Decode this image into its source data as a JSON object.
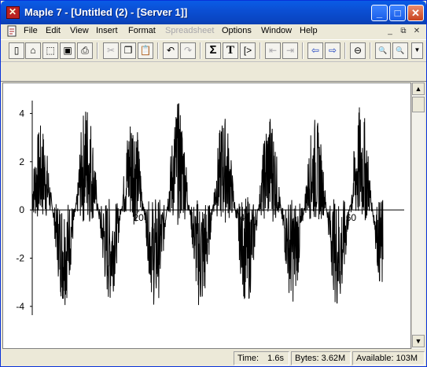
{
  "window": {
    "title": "Maple 7  - [Untitled (2) - [Server 1]]",
    "controls": {
      "minimize": "_",
      "maximize": "□",
      "close": "✕"
    }
  },
  "menubar": {
    "items": [
      "File",
      "Edit",
      "View",
      "Insert",
      "Format",
      "Spreadsheet",
      "Options",
      "Window",
      "Help"
    ],
    "disabled": [
      "Spreadsheet"
    ],
    "mdi_controls": [
      "_",
      "⧉",
      "✕"
    ]
  },
  "toolbar": {
    "buttons": [
      {
        "icon": "new-document-icon",
        "glyph": "▯"
      },
      {
        "icon": "open-folder-icon",
        "glyph": "⌂"
      },
      {
        "icon": "open-url-icon",
        "glyph": "⬚"
      },
      {
        "icon": "save-icon",
        "glyph": "▣"
      },
      {
        "icon": "print-icon",
        "glyph": "⎙"
      },
      {
        "icon": "cut-icon",
        "glyph": "✂",
        "disabled": true
      },
      {
        "icon": "copy-icon",
        "glyph": "❐"
      },
      {
        "icon": "paste-icon",
        "glyph": "📋"
      },
      {
        "icon": "undo-icon",
        "glyph": "↶"
      },
      {
        "icon": "redo-icon",
        "glyph": "↷",
        "disabled": true
      },
      {
        "icon": "sigma-math-icon",
        "glyph": "Σ"
      },
      {
        "icon": "text-mode-icon",
        "glyph": "T"
      },
      {
        "icon": "exec-group-icon",
        "glyph": "[>"
      },
      {
        "icon": "outdent-icon",
        "glyph": "⇤",
        "disabled": true
      },
      {
        "icon": "indent-icon",
        "glyph": "⇥",
        "disabled": true
      },
      {
        "icon": "back-icon",
        "glyph": "⇦"
      },
      {
        "icon": "forward-icon",
        "glyph": "⇨"
      },
      {
        "icon": "stop-icon",
        "glyph": "⊖"
      },
      {
        "icon": "zoom-in-icon",
        "glyph": "🔍"
      },
      {
        "icon": "zoom-out-icon",
        "glyph": "🔍"
      },
      {
        "icon": "toolbar-more-icon",
        "glyph": "▼"
      }
    ]
  },
  "chart_data": {
    "type": "line",
    "yticks": [
      "4",
      "2",
      "0",
      "-2",
      "-4"
    ],
    "xticks": [
      "20",
      "40",
      "60"
    ],
    "xlim": [
      0,
      70
    ],
    "ylim": [
      -4.2,
      4.6
    ],
    "color": "#000000",
    "period": 8.6,
    "amplitude_peaks": [
      3.4,
      4.4,
      4.1,
      4.3,
      3.8,
      3.9,
      3.7,
      4.2
    ],
    "amplitude_troughs": [
      -3.8,
      -3.7,
      -3.9,
      -4.1,
      -3.8,
      -3.7,
      -4.0,
      -3.6
    ],
    "description_of_series": "noisy periodic signal, approx. 8 cycles between x=0 and x=66"
  },
  "status": {
    "time_label": "Time:",
    "time_value": "1.6s",
    "bytes_label": "Bytes:",
    "bytes_value": "3.62M",
    "available_label": "Available:",
    "available_value": "103M"
  }
}
